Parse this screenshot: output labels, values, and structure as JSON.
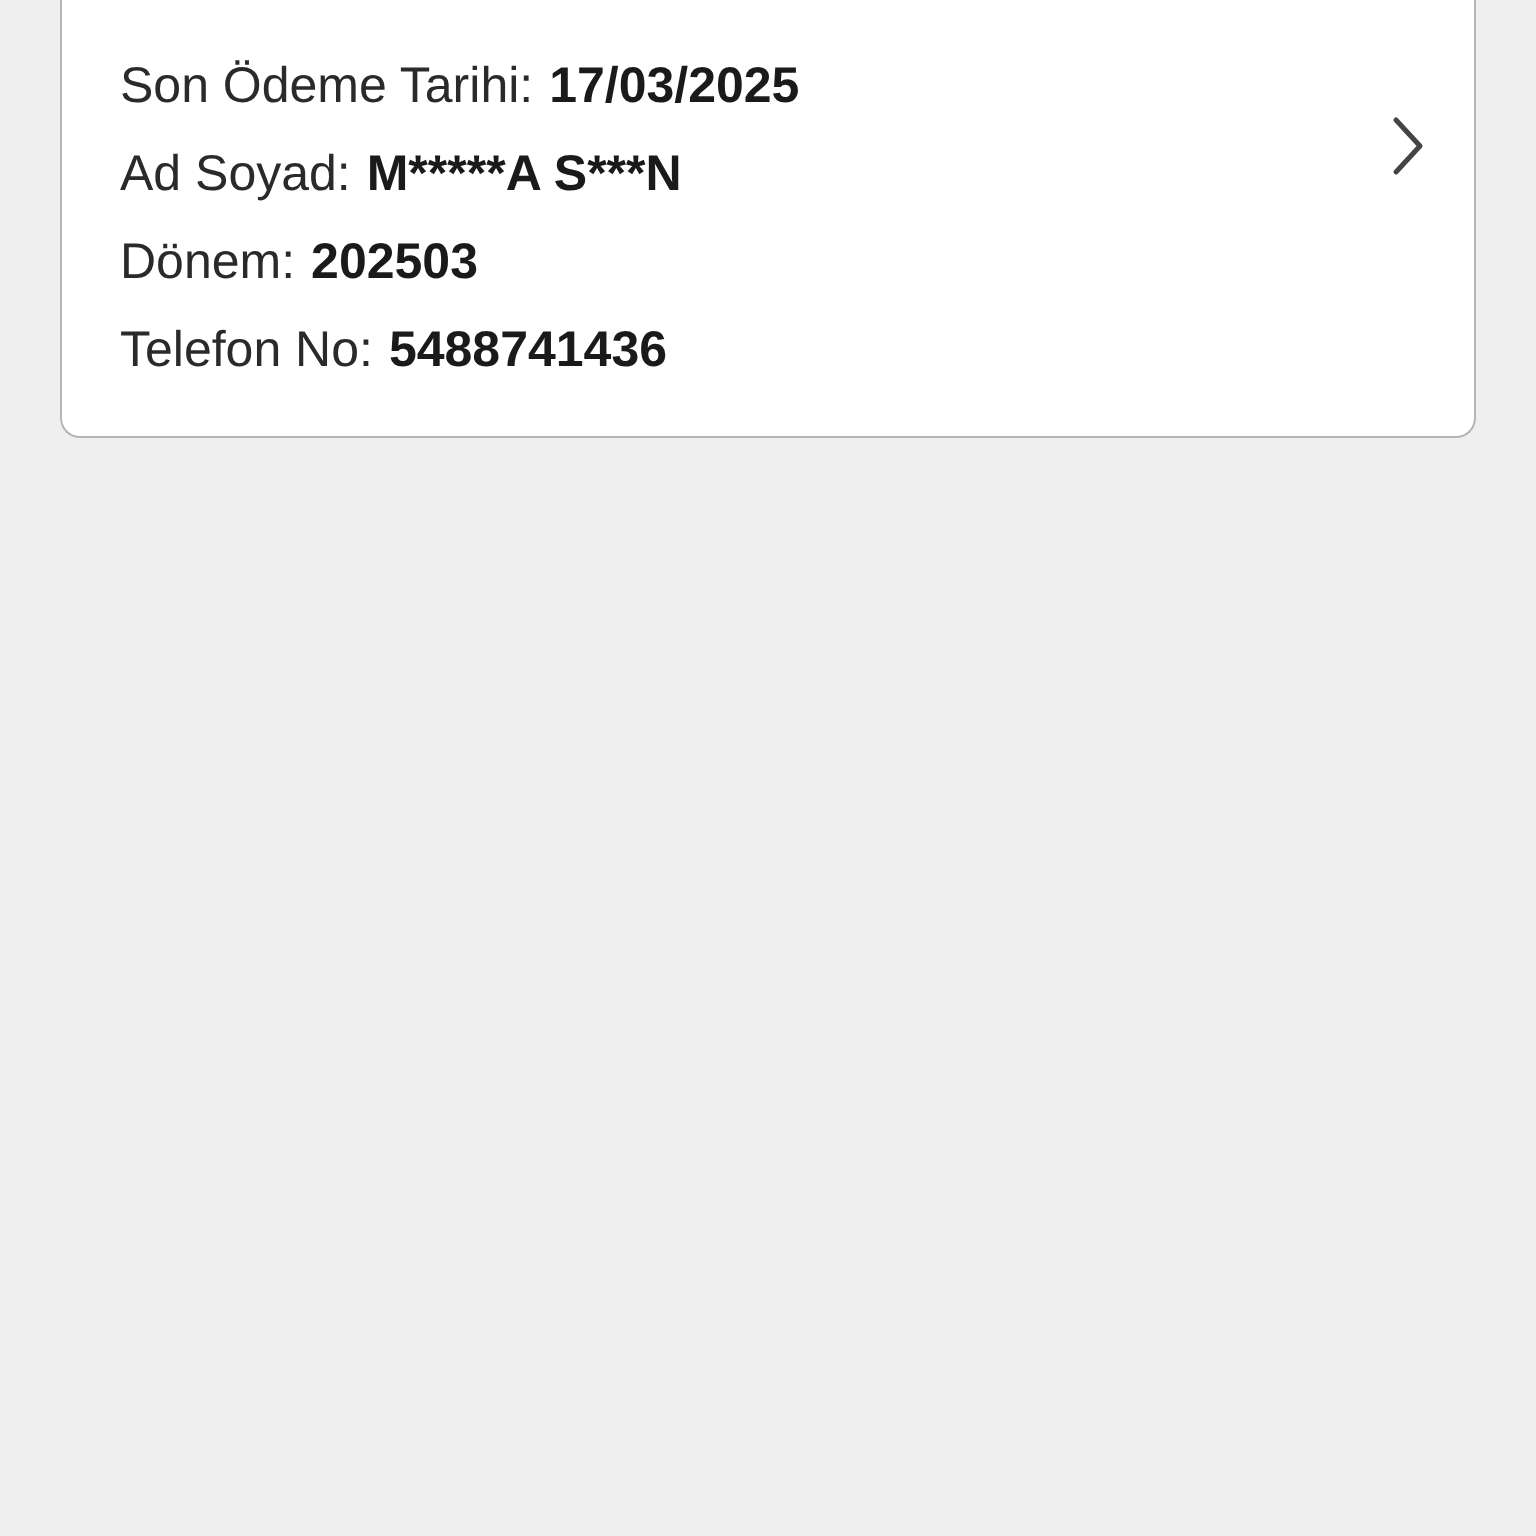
{
  "card": {
    "rows": [
      {
        "label": "Son Ödeme Tarihi:",
        "value": "17/03/2025"
      },
      {
        "label": "Ad Soyad:",
        "value": "M*****A S***N"
      },
      {
        "label": "Dönem:",
        "value": "202503"
      },
      {
        "label": "Telefon No:",
        "value": "5488741436"
      }
    ]
  }
}
